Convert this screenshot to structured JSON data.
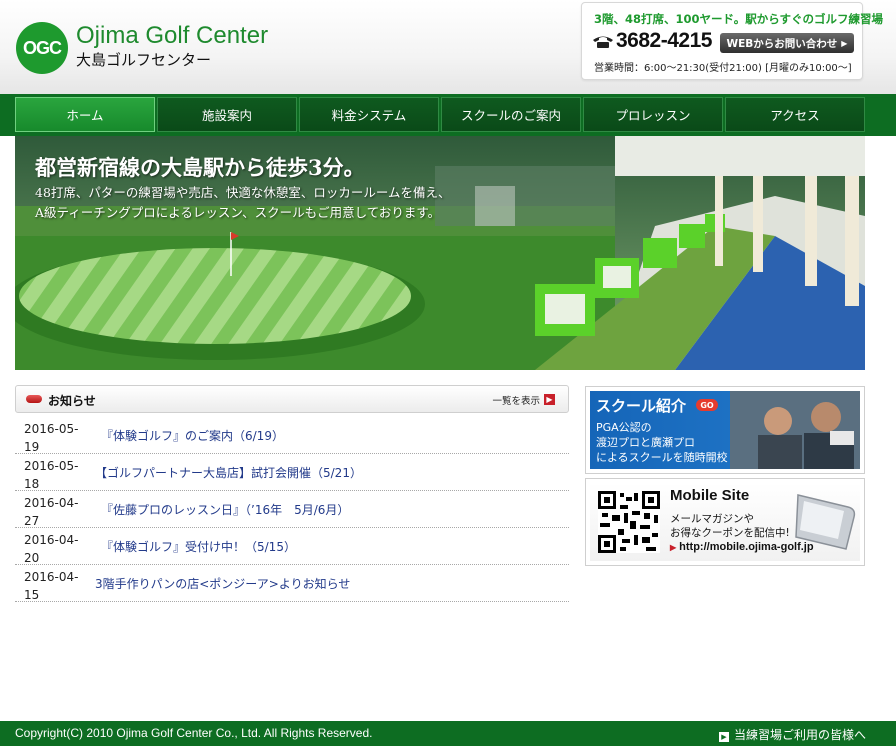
{
  "brand": {
    "logo_mark": "OGC",
    "name_en": "Ojima Golf Center",
    "name_jp": "大島ゴルフセンター"
  },
  "contact": {
    "tagline": "3階、48打席、100ヤード。駅からすぐのゴルフ練習場",
    "phone": "3682-4215",
    "web_button": "WEBからお問い合わせ",
    "hours": "営業時間：6:00～21:30(受付21:00) [月曜のみ10:00～]",
    "icon": "phone-icon"
  },
  "nav": {
    "items": [
      {
        "label": "ホーム"
      },
      {
        "label": "施設案内"
      },
      {
        "label": "料金システム"
      },
      {
        "label": "スクールのご案内"
      },
      {
        "label": "プロレッスン"
      },
      {
        "label": "アクセス"
      }
    ]
  },
  "hero": {
    "headline": "都営新宿線の大島駅から徒歩3分。",
    "line1": "48打席、パターの練習場や売店、快適な休憩室、ロッカールームを備え、",
    "line2": "A級ティーチングプロによるレッスン、スクールもご用意しております。"
  },
  "news": {
    "title": "お知らせ",
    "view_all": "一覧を表示",
    "items": [
      {
        "date": "2016-05-19",
        "title": "『体験ゴルフ』のご案内（6/19）"
      },
      {
        "date": "2016-05-18",
        "title": "【ゴルフパートナー大島店】試打会開催（5/21）"
      },
      {
        "date": "2016-04-27",
        "title": "『佐藤プロのレッスン日』（’16年　5月/6月）"
      },
      {
        "date": "2016-04-20",
        "title": "『体験ゴルフ』受付け中！（5/15）"
      },
      {
        "date": "2016-04-15",
        "title": "3階手作りパンの店<ポンジーア>よりお知らせ"
      }
    ]
  },
  "school_banner": {
    "title": "スクール紹介",
    "badge": "GO",
    "line1": "PGA公認の",
    "line2": "渡辺プロと廣瀬プロ",
    "line3": "によるスクールを随時開校"
  },
  "mobile_banner": {
    "title": "Mobile Site",
    "line1": "メールマガジンや",
    "line2": "お得なクーポンを配信中!",
    "url": "http://mobile.ojima-golf.jp"
  },
  "footer": {
    "copyright": "Copyright(C) 2010 Ojima Golf Center Co., Ltd. All Rights Reserved.",
    "notice_link": "当練習場ご利用の皆様へ"
  },
  "colors": {
    "brand_green": "#1e9a2e",
    "nav_green": "#0d6d22",
    "accent_red": "#c8202a",
    "link_blue": "#223a8a"
  }
}
